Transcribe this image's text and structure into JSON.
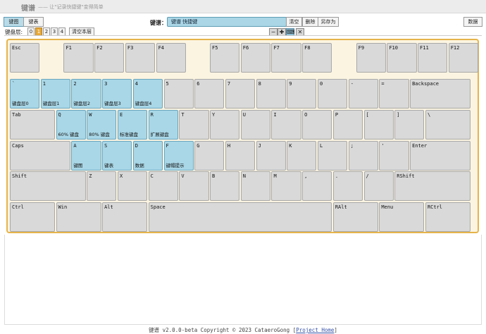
{
  "app": {
    "title": "键谱",
    "subtitle": "—— 让\"记录快捷键\"变得简单"
  },
  "tabs": [
    {
      "label": "键图",
      "active": true
    },
    {
      "label": "键表",
      "active": false
    }
  ],
  "name_label": "键谱：",
  "name_value": "键谱 快捷键",
  "actions": {
    "clear": "清空",
    "delete": "删除",
    "save_as": "另存为",
    "data": "数据"
  },
  "layer": {
    "label": "键盘层:",
    "options": [
      "0",
      "1",
      "2",
      "3",
      "4"
    ],
    "active": "1",
    "clear_label": "清空本层"
  },
  "toolbar_icons": [
    "minus-icon",
    "plus-icon",
    "keyboard-icon",
    "tools-icon"
  ],
  "keyboard": {
    "rows": [
      [
        {
          "id": "esc",
          "label": "Esc"
        },
        {
          "id": "f1",
          "label": "F1"
        },
        {
          "id": "f2",
          "label": "F2"
        },
        {
          "id": "f3",
          "label": "F3"
        },
        {
          "id": "f4",
          "label": "F4"
        },
        {
          "id": "f5",
          "label": "F5"
        },
        {
          "id": "f6",
          "label": "F6"
        },
        {
          "id": "f7",
          "label": "F7"
        },
        {
          "id": "f8",
          "label": "F8"
        },
        {
          "id": "f9",
          "label": "F9"
        },
        {
          "id": "f10",
          "label": "F10"
        },
        {
          "id": "f11",
          "label": "F11"
        },
        {
          "id": "f12",
          "label": "F12"
        }
      ],
      [
        {
          "id": "grave",
          "label": "`",
          "binding": "键盘层0"
        },
        {
          "id": "d1",
          "label": "1",
          "binding": "键盘层1"
        },
        {
          "id": "d2",
          "label": "2",
          "binding": "键盘层2"
        },
        {
          "id": "d3",
          "label": "3",
          "binding": "键盘层3"
        },
        {
          "id": "d4",
          "label": "4",
          "binding": "键盘层4"
        },
        {
          "id": "d5",
          "label": "5"
        },
        {
          "id": "d6",
          "label": "6"
        },
        {
          "id": "d7",
          "label": "7"
        },
        {
          "id": "d8",
          "label": "8"
        },
        {
          "id": "d9",
          "label": "9"
        },
        {
          "id": "d0",
          "label": "0"
        },
        {
          "id": "minus",
          "label": "-"
        },
        {
          "id": "equal",
          "label": "="
        },
        {
          "id": "backspace",
          "label": "Backspace"
        }
      ],
      [
        {
          "id": "tab",
          "label": "Tab"
        },
        {
          "id": "q",
          "label": "Q",
          "binding": "60% 键盘"
        },
        {
          "id": "w",
          "label": "W",
          "binding": "80% 键盘"
        },
        {
          "id": "e",
          "label": "E",
          "binding": "标准键盘"
        },
        {
          "id": "r",
          "label": "R",
          "binding": "扩展键盘"
        },
        {
          "id": "t",
          "label": "T"
        },
        {
          "id": "y",
          "label": "Y"
        },
        {
          "id": "u",
          "label": "U"
        },
        {
          "id": "i",
          "label": "I"
        },
        {
          "id": "o",
          "label": "O"
        },
        {
          "id": "p",
          "label": "P"
        },
        {
          "id": "lbracket",
          "label": "["
        },
        {
          "id": "rbracket",
          "label": "]"
        },
        {
          "id": "backslash",
          "label": "\\"
        }
      ],
      [
        {
          "id": "caps",
          "label": "Caps"
        },
        {
          "id": "a",
          "label": "A",
          "binding": "键图"
        },
        {
          "id": "s",
          "label": "S",
          "binding": "键表"
        },
        {
          "id": "d",
          "label": "D",
          "binding": "数据"
        },
        {
          "id": "f",
          "label": "F",
          "binding": "键帽提示"
        },
        {
          "id": "g",
          "label": "G"
        },
        {
          "id": "h",
          "label": "H"
        },
        {
          "id": "j",
          "label": "J"
        },
        {
          "id": "k",
          "label": "K"
        },
        {
          "id": "l",
          "label": "L"
        },
        {
          "id": "semicolon",
          "label": ";"
        },
        {
          "id": "quote",
          "label": "'"
        },
        {
          "id": "enter",
          "label": "Enter"
        }
      ],
      [
        {
          "id": "lshift",
          "label": "Shift"
        },
        {
          "id": "z",
          "label": "Z"
        },
        {
          "id": "x",
          "label": "X"
        },
        {
          "id": "c",
          "label": "C"
        },
        {
          "id": "v",
          "label": "V"
        },
        {
          "id": "b",
          "label": "B"
        },
        {
          "id": "n",
          "label": "N"
        },
        {
          "id": "m",
          "label": "M"
        },
        {
          "id": "comma",
          "label": ","
        },
        {
          "id": "period",
          "label": "."
        },
        {
          "id": "slash",
          "label": "/"
        },
        {
          "id": "rshift",
          "label": "RShift"
        }
      ],
      [
        {
          "id": "ctrl",
          "label": "Ctrl"
        },
        {
          "id": "win",
          "label": "Win"
        },
        {
          "id": "alt",
          "label": "Alt"
        },
        {
          "id": "space",
          "label": "Space"
        },
        {
          "id": "ralt",
          "label": "RAlt"
        },
        {
          "id": "menu",
          "label": "Menu"
        },
        {
          "id": "rctrl",
          "label": "RCtrl"
        }
      ]
    ]
  },
  "footer": {
    "text": "键谱 v2.0.0-beta Copyright © 2023 CataeroGong [",
    "link": "Project Home",
    "suffix": "]"
  }
}
